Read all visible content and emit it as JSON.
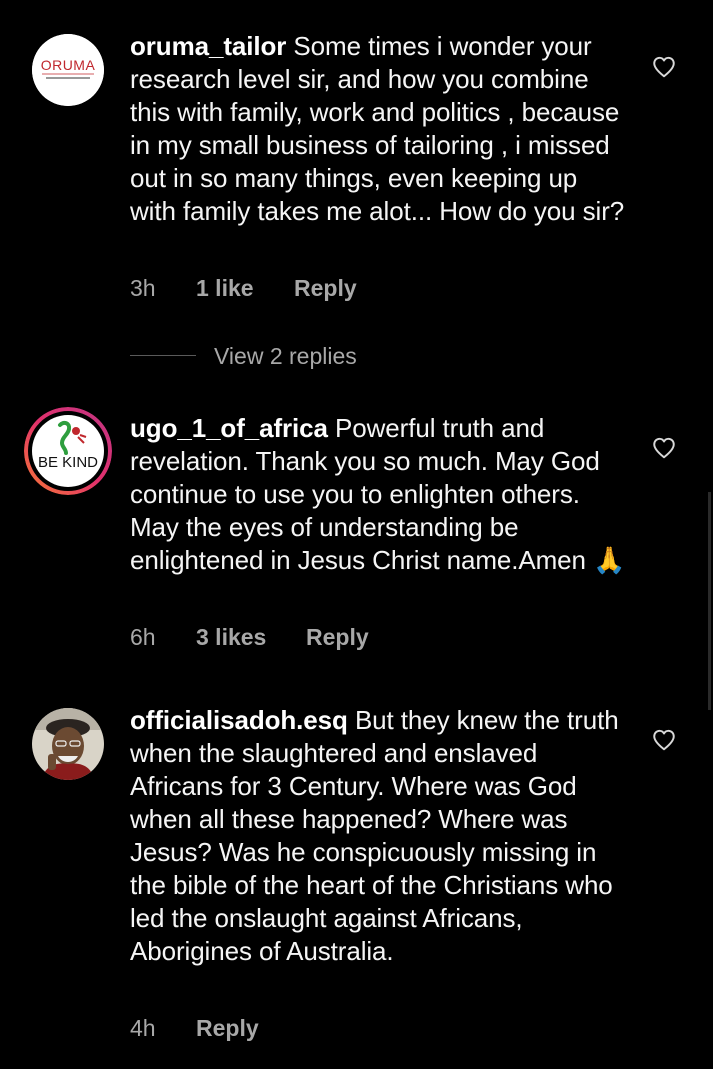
{
  "comments": [
    {
      "username": "oruma_tailor",
      "text": "Some times i wonder your research level sir, and how you combine this with family, work and politics , because in my small business of tailoring , i missed out in so many things, even keeping up with family takes me alot... How do you sir?",
      "time": "3h",
      "likes": "1 like",
      "reply": "Reply",
      "avatar": {
        "type": "logo",
        "logo_text": "ORUMA",
        "logo_color": "#c0272d"
      },
      "like_icon": "heart-outline-icon"
    },
    {
      "username": "ugo_1_of_africa",
      "text": "Powerful truth and revelation. Thank you so much. May God continue to use you to enlighten others. May the eyes of understanding be enlightened in Jesus Christ name.Amen 🙏",
      "time": "6h",
      "likes": "3 likes",
      "reply": "Reply",
      "avatar": {
        "type": "sticker",
        "sticker_text": "BE KIND",
        "ring_colors": [
          "#c13584",
          "#e1306c",
          "#f77737"
        ]
      },
      "like_icon": "heart-outline-icon"
    },
    {
      "username": "officialisadoh.esq",
      "text": "But they knew the truth when the slaughtered and enslaved Africans for 3 Century. Where was God when all these happened? Where was Jesus? Was he conspicuously missing in the bible of the heart of the Christians who led the onslaught against Africans, Aborigines of Australia.",
      "time": "4h",
      "likes": "",
      "reply": "Reply",
      "avatar": {
        "type": "photo",
        "subject": "elderly man in cap"
      },
      "like_icon": "heart-outline-icon"
    }
  ],
  "thread": {
    "view_replies": "View 2 replies"
  },
  "colors": {
    "background": "#000000",
    "text": "#f5f5f5",
    "meta": "#a8a8a8"
  }
}
